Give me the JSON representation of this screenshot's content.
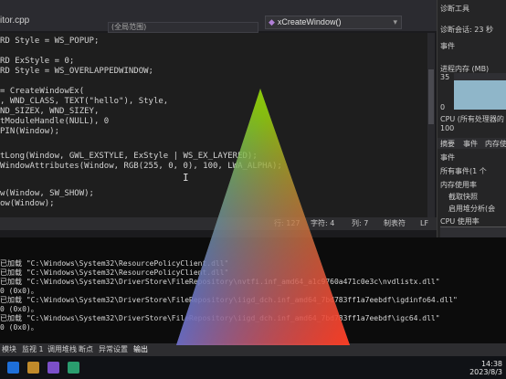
{
  "tab": {
    "file": "itor.cpp",
    "scope": "(全局范围)",
    "function": "xCreateWindow()"
  },
  "code_lines": [
    "RD Style = WS_POPUP;",
    "",
    "RD ExStyle = 0;",
    "RD Style = WS_OVERLAPPEDWINDOW;",
    "",
    "",
    "= CreateWindowEx(",
    ", WND_CLASS, TEXT(\"hello\"), Style,",
    "ND_SIZEX, WND_SIZEY,",
    "tModuleHandle(NULL), 0",
    "",
    "",
    "PIN(Window);",
    "",
    "",
    "tLong(Window, GWL_EXSTYLE, ExStyle | WS_EX_LAYERED);",
    "WindowAttributes(Window, RGB(255, 0, 0), 100, LWA_ALPHA);",
    "",
    "",
    "w(Window, SW_SHOW);",
    "ow(Window);"
  ],
  "status": {
    "line": "行: 127",
    "char": "字符: 4",
    "col": "列: 7",
    "mode": "制表符",
    "eol": "LF"
  },
  "diagnostics": {
    "title": "诊断工具",
    "session": "诊断会话: 23 秒",
    "events": "事件",
    "process_memory": "进程内存 (MB)",
    "mem_max": "35",
    "mem_min": "0",
    "cpu": "CPU (所有处理器的",
    "cpu_max": "100",
    "tabs": [
      "摘要",
      "事件",
      "内存使用"
    ],
    "events_label": "事件",
    "all_events": "所有事件(1 个",
    "memory_usage": "内存使用率",
    "snapshot": "截取快照",
    "heap_analysis": "启用堆分析(会",
    "cpu_usage": "CPU 使用率"
  },
  "output_lines": [
    "已加载 \"C:\\Windows\\System32\\ResourcePolicyClient.dll\"",
    "已加载 \"C:\\Windows\\System32\\ResourcePolicyClient.dll\"",
    "已加载 \"C:\\Windows\\System32\\DriverStore\\FileRepository\\nvtfi.inf_amd64_a1c9760a471c0e3c\\nvdlistx.dll\"",
    "0 (0x0)。",
    "已加载 \"C:\\Windows\\System32\\DriverStore\\FileRepository\\iigd_dch.inf_amd64_7bd783ff1a7eebdf\\igdinfo64.dll\"",
    "0 (0x0)。",
    "已加载 \"C:\\Windows\\System32\\DriverStore\\FileRepository\\iigd_dch.inf_amd64_7bd783ff1a7eebdf\\igc64.dll\"",
    "0 (0x0)。"
  ],
  "bottom_tabs": [
    "模块",
    "监视 1",
    "调用堆栈",
    "断点",
    "异常设置",
    "输出"
  ],
  "active_bottom_tab": "输出",
  "clock": {
    "time": "14:38",
    "date": "2023/8/3"
  },
  "colors": {
    "accent": "#007acc",
    "triangle_top": "#8fd400",
    "triangle_left": "#2f7bff",
    "triangle_right": "#ff3b1f"
  }
}
